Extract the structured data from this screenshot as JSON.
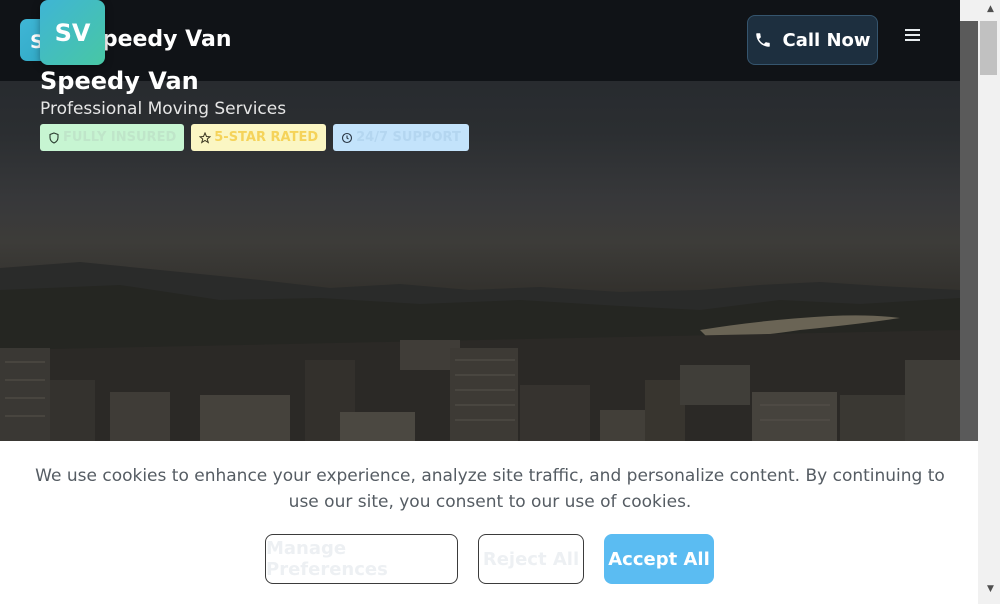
{
  "navbar": {
    "logo_small": "S",
    "brand_name": "Speedy Van",
    "call_button": "Call Now"
  },
  "hero": {
    "logo_big": "SV",
    "title": "Speedy Van",
    "subtitle": "Professional Moving Services",
    "badges": [
      {
        "label": "FULLY INSURED",
        "icon": "shield-icon"
      },
      {
        "label": "5-STAR RATED",
        "icon": "star-icon"
      },
      {
        "label": "24/7 SUPPORT",
        "icon": "clock-icon"
      }
    ]
  },
  "cookie_banner": {
    "text": "We use cookies to enhance your experience, analyze site traffic, and personalize content. By continuing to use our site, you consent to our use of cookies.",
    "manage_label": "Manage Preferences",
    "reject_label": "Reject All",
    "accept_label": "Accept All"
  },
  "colors": {
    "navbar_bg": "#101317",
    "accent": "#5bbcf2",
    "logo_gradient_start": "#3fb5d5",
    "logo_gradient_end": "#48c7a4"
  }
}
